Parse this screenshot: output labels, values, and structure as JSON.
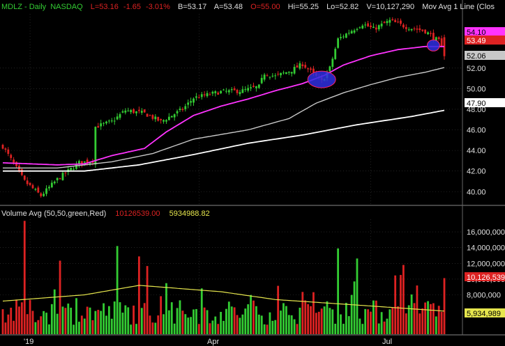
{
  "header": {
    "symbol": "MDLZ - Daily",
    "exchange": "NASDAQ",
    "last": "L=53.16",
    "change": "-1.65",
    "pct_change": "-3.01%",
    "bid": "B=53.17",
    "ask": "A=53.48",
    "open": "O=55.00",
    "high": "Hi=55.25",
    "low": "Lo=52.82",
    "volume": "V=10,127,290",
    "study": "Mov Avg 1 Line (Clos"
  },
  "volume_header": {
    "label": "Volume Avg (50,50,green,Red)",
    "value_red": "10126539.00",
    "value_yellow": "5934988.82"
  },
  "colors": {
    "background": "#000000",
    "up": "#33cc33",
    "down": "#dd2222",
    "ma50": "#ff33ff",
    "ma100": "#c8c8c8",
    "ma200": "#ffffff",
    "vol_avg": "#e6e64d",
    "grid": "#3a3a3a"
  },
  "chart_data": [
    {
      "type": "candlestick",
      "title": "MDLZ - Daily NASDAQ",
      "x_ticks": [
        "'19",
        "Apr",
        "Jul"
      ],
      "y_ticks": [
        40.0,
        42.0,
        44.0,
        46.0,
        48.0,
        50.0,
        52.0
      ],
      "ylim": [
        38.8,
        57.4
      ],
      "grid": true,
      "price_labels": [
        {
          "text": "54.10",
          "kind": "ma50"
        },
        {
          "text": "53.49",
          "kind": "last"
        },
        {
          "text": "52.06",
          "kind": "ma100"
        },
        {
          "text": "47.90",
          "kind": "ma200"
        }
      ],
      "anchors": {
        "close": [
          [
            0,
            44.4
          ],
          [
            8,
            41.0
          ],
          [
            14,
            39.6
          ],
          [
            20,
            41.2
          ],
          [
            28,
            42.8
          ],
          [
            33,
            43.0
          ],
          [
            34,
            46.3
          ],
          [
            40,
            46.8
          ],
          [
            45,
            47.9
          ],
          [
            52,
            47.6
          ],
          [
            58,
            46.8
          ],
          [
            66,
            48.0
          ],
          [
            70,
            49.1
          ],
          [
            80,
            49.7
          ],
          [
            88,
            49.8
          ],
          [
            94,
            50.2
          ],
          [
            96,
            51.5
          ],
          [
            100,
            51.2
          ],
          [
            106,
            51.8
          ],
          [
            110,
            52.4
          ],
          [
            117,
            50.7
          ],
          [
            120,
            52.0
          ],
          [
            123,
            54.8
          ],
          [
            127,
            55.5
          ],
          [
            132,
            56.3
          ],
          [
            136,
            55.8
          ],
          [
            142,
            56.6
          ],
          [
            148,
            56.0
          ],
          [
            155,
            55.6
          ],
          [
            160,
            54.6
          ],
          [
            162,
            53.16
          ]
        ],
        "ma50": [
          [
            0,
            42.8
          ],
          [
            10,
            42.7
          ],
          [
            20,
            42.6
          ],
          [
            30,
            42.7
          ],
          [
            40,
            43.5
          ],
          [
            52,
            44.2
          ],
          [
            60,
            45.8
          ],
          [
            70,
            47.4
          ],
          [
            80,
            48.3
          ],
          [
            90,
            49.0
          ],
          [
            100,
            49.8
          ],
          [
            110,
            50.5
          ],
          [
            118,
            51.3
          ],
          [
            125,
            52.3
          ],
          [
            135,
            53.2
          ],
          [
            145,
            53.8
          ],
          [
            155,
            54.1
          ],
          [
            162,
            54.1
          ]
        ],
        "ma100": [
          [
            0,
            42.3
          ],
          [
            20,
            42.3
          ],
          [
            40,
            42.9
          ],
          [
            55,
            43.7
          ],
          [
            70,
            45.1
          ],
          [
            90,
            46.0
          ],
          [
            105,
            47.1
          ],
          [
            115,
            48.6
          ],
          [
            125,
            49.6
          ],
          [
            135,
            50.4
          ],
          [
            145,
            51.1
          ],
          [
            155,
            51.6
          ],
          [
            162,
            52.06
          ]
        ],
        "ma200": [
          [
            0,
            42.0
          ],
          [
            30,
            42.0
          ],
          [
            50,
            42.6
          ],
          [
            70,
            43.6
          ],
          [
            90,
            44.7
          ],
          [
            110,
            45.5
          ],
          [
            130,
            46.5
          ],
          [
            150,
            47.3
          ],
          [
            162,
            47.9
          ]
        ]
      },
      "highlights": [
        {
          "bar": 117,
          "price": 50.9,
          "color": "#2f2fe0",
          "outline": "#ff2266"
        },
        {
          "bar": 158,
          "price": 54.2,
          "color": "#2f2fe0",
          "outline": "#ff2266"
        }
      ]
    },
    {
      "type": "bar",
      "title": "Volume Avg (50,50,green,Red)",
      "y_ticks": [
        8000000,
        10000000,
        12000000,
        14000000,
        16000000
      ],
      "y_tick_labels": [
        "8,000,000",
        "10,000,000",
        "12,000,000",
        "14,000,000",
        "16,000,000"
      ],
      "ylim": [
        3000000,
        17600000
      ],
      "latest_volume": 10126539,
      "average_volume": 5934988.82,
      "value_labels": [
        {
          "text": "10,126,539",
          "kind": "last"
        },
        {
          "text": "5,934,989",
          "kind": "avg"
        }
      ],
      "avg_anchors": [
        [
          0,
          7200000
        ],
        [
          30,
          8000000
        ],
        [
          50,
          9200000
        ],
        [
          80,
          8400000
        ],
        [
          100,
          7400000
        ],
        [
          130,
          6700000
        ],
        [
          162,
          5934989
        ]
      ]
    }
  ]
}
